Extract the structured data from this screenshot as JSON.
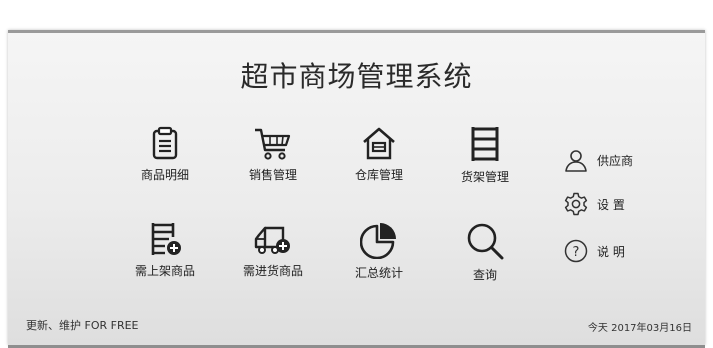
{
  "title": "超市商场管理系统",
  "tiles": [
    {
      "label": "商品明细",
      "icon": "clipboard-icon"
    },
    {
      "label": "销售管理",
      "icon": "shopping-cart-icon"
    },
    {
      "label": "仓库管理",
      "icon": "warehouse-icon"
    },
    {
      "label": "货架管理",
      "icon": "shelf-icon"
    },
    {
      "label": "需上架商品",
      "icon": "shelf-add-icon"
    },
    {
      "label": "需进货商品",
      "icon": "delivery-truck-icon"
    },
    {
      "label": "汇总统计",
      "icon": "pie-chart-icon"
    },
    {
      "label": "查询",
      "icon": "search-icon"
    }
  ],
  "side": [
    {
      "label": "供应商",
      "icon": "user-icon"
    },
    {
      "label": "设  置",
      "icon": "gear-icon"
    },
    {
      "label": "说  明",
      "icon": "help-icon"
    }
  ],
  "footer": {
    "left": "更新、维护  FOR FREE",
    "right": "今天  2017年03月16日"
  }
}
